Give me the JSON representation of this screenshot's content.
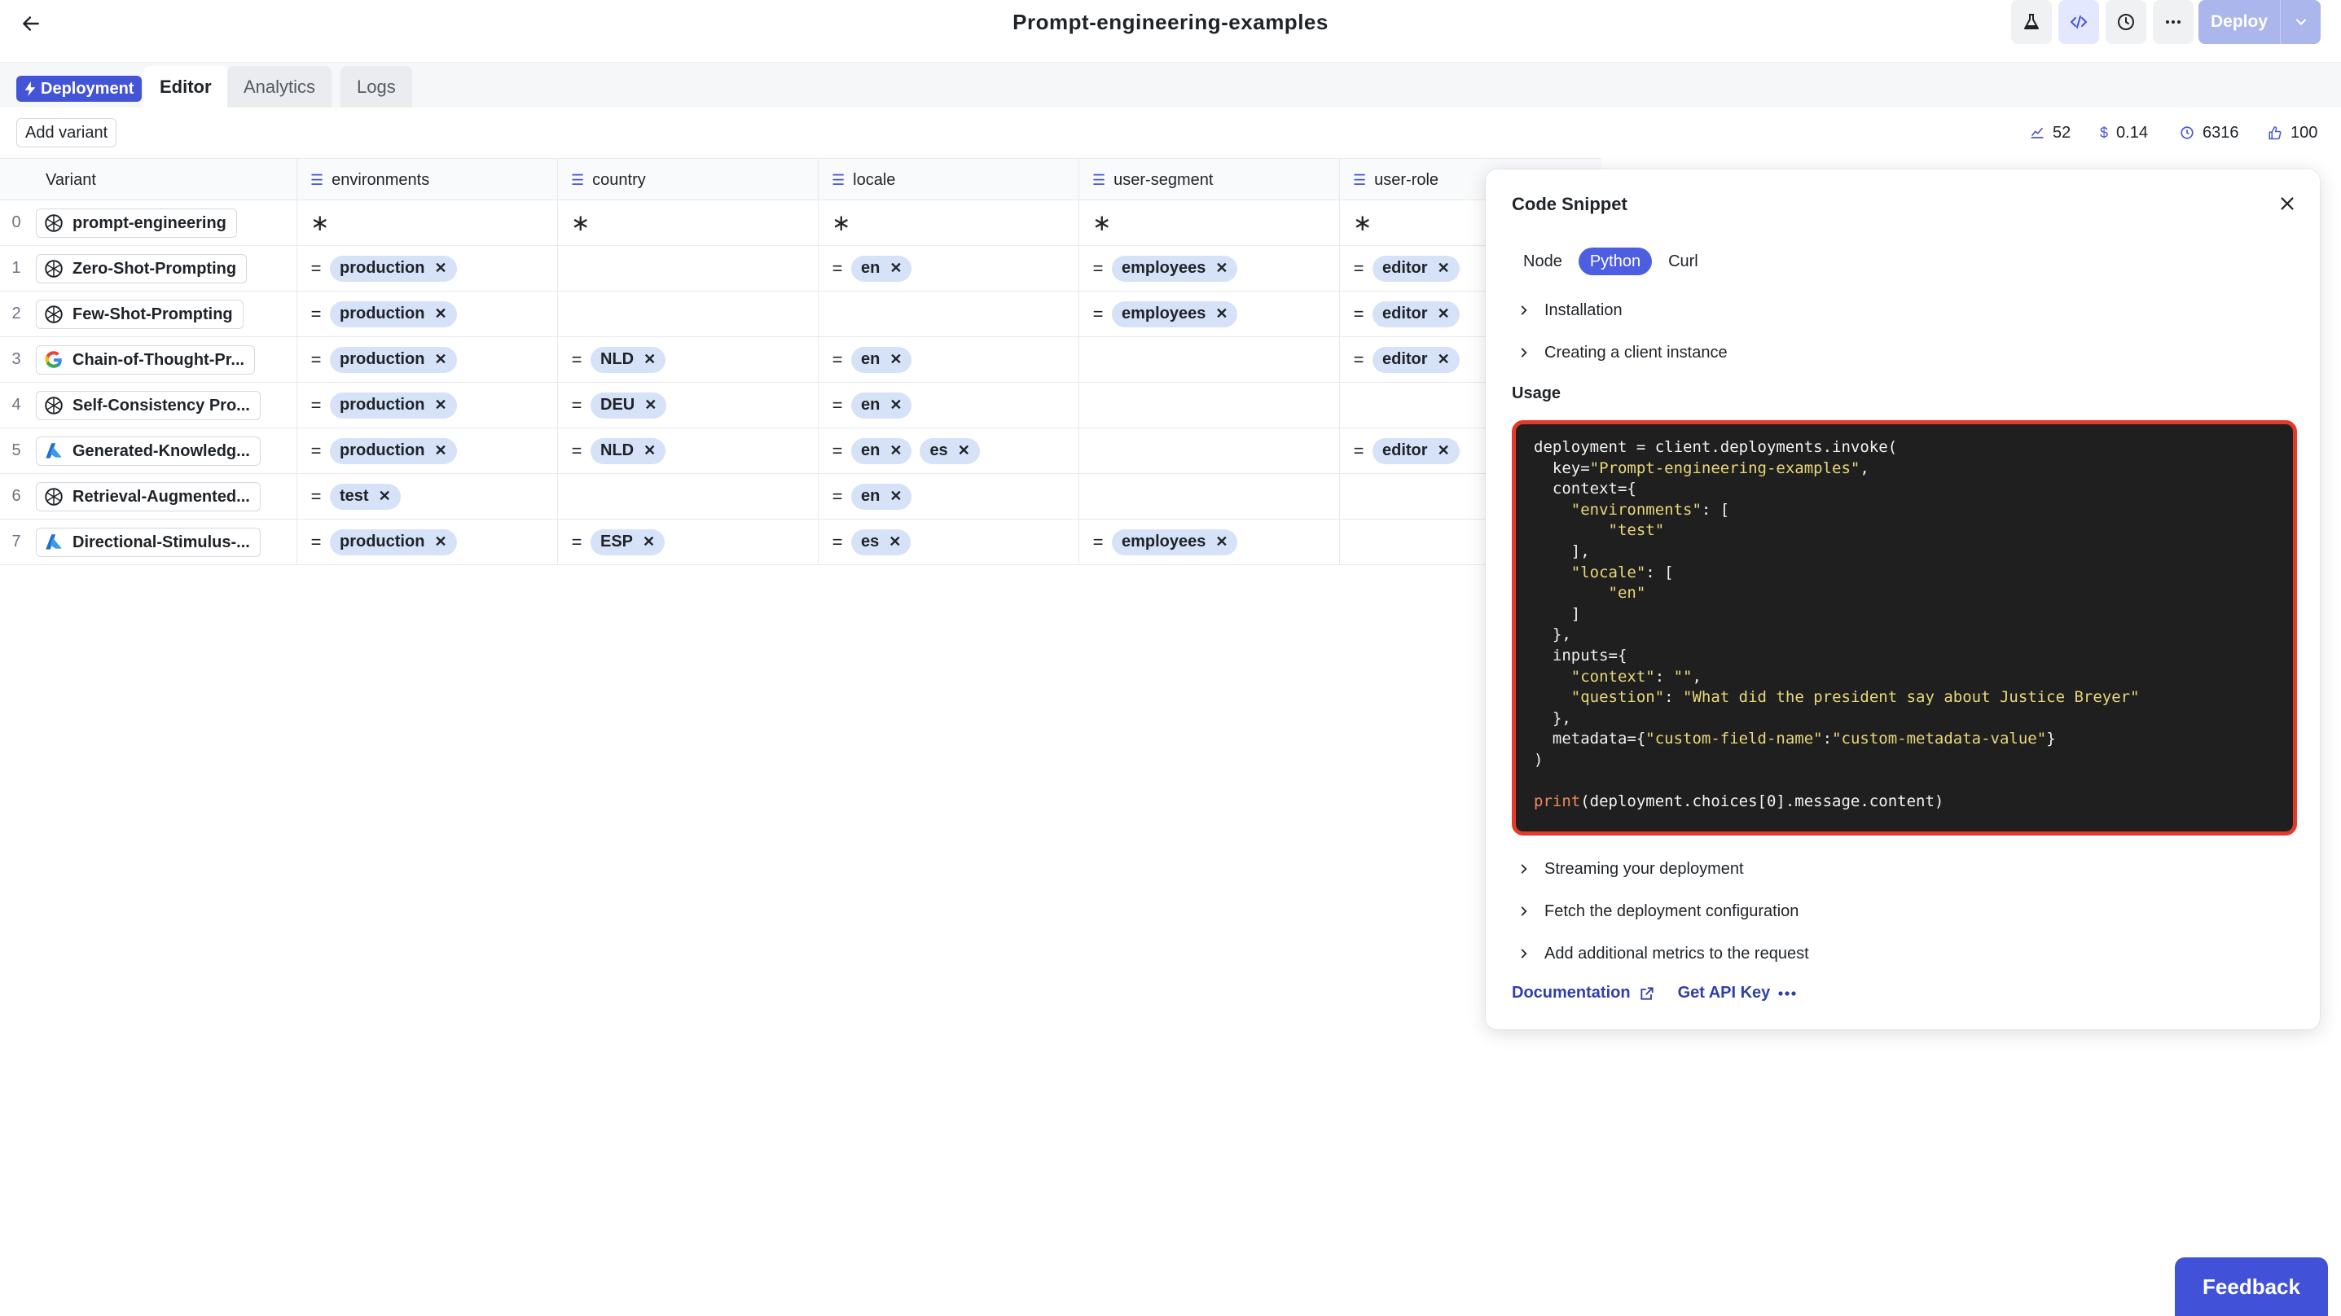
{
  "header": {
    "title": "Prompt-engineering-examples",
    "deploy_label": "Deploy"
  },
  "tabs": {
    "badge": "Deployment",
    "items": [
      "Editor",
      "Analytics",
      "Logs"
    ],
    "active": "Editor"
  },
  "toolbar": {
    "add_variant": "Add variant",
    "metrics": [
      {
        "icon": "chart-line-icon",
        "value": "52"
      },
      {
        "icon": "dollar-icon",
        "value": "0.14"
      },
      {
        "icon": "clock-icon",
        "value": "6316"
      },
      {
        "icon": "thumbs-up-icon",
        "value": "100"
      }
    ]
  },
  "table": {
    "columns": [
      "Variant",
      "environments",
      "country",
      "locale",
      "user-segment",
      "user-role"
    ],
    "rows": [
      {
        "idx": "0",
        "name": "prompt-engineering",
        "provider": "openai",
        "environments": [
          "*"
        ],
        "country": [
          "*"
        ],
        "locale": [
          "*"
        ],
        "segment": [
          "*"
        ],
        "role": [
          "*"
        ],
        "wildcard": true
      },
      {
        "idx": "1",
        "name": "Zero-Shot-Prompting",
        "provider": "openai",
        "environments": [
          "production"
        ],
        "country": [],
        "locale": [
          "en"
        ],
        "segment": [
          "employees"
        ],
        "role": [
          "editor"
        ]
      },
      {
        "idx": "2",
        "name": "Few-Shot-Prompting",
        "provider": "openai",
        "environments": [
          "production"
        ],
        "country": [],
        "locale": [],
        "segment": [
          "employees"
        ],
        "role": [
          "editor"
        ]
      },
      {
        "idx": "3",
        "name": "Chain-of-Thought-Pr...",
        "provider": "google",
        "environments": [
          "production"
        ],
        "country": [
          "NLD"
        ],
        "locale": [
          "en"
        ],
        "segment": [],
        "role": [
          "editor"
        ]
      },
      {
        "idx": "4",
        "name": "Self-Consistency Pro...",
        "provider": "openai",
        "environments": [
          "production"
        ],
        "country": [
          "DEU"
        ],
        "locale": [
          "en"
        ],
        "segment": [],
        "role": []
      },
      {
        "idx": "5",
        "name": "Generated-Knowledg...",
        "provider": "azure",
        "environments": [
          "production"
        ],
        "country": [
          "NLD"
        ],
        "locale": [
          "en",
          "es"
        ],
        "segment": [],
        "role": [
          "editor"
        ]
      },
      {
        "idx": "6",
        "name": "Retrieval-Augmented...",
        "provider": "openai",
        "environments": [
          "test"
        ],
        "country": [],
        "locale": [
          "en"
        ],
        "segment": [],
        "role": []
      },
      {
        "idx": "7",
        "name": "Directional-Stimulus-...",
        "provider": "azure",
        "environments": [
          "production"
        ],
        "country": [
          "ESP"
        ],
        "locale": [
          "es"
        ],
        "segment": [
          "employees"
        ],
        "role": []
      }
    ]
  },
  "panel": {
    "title": "Code Snippet",
    "languages": [
      "Node",
      "Python",
      "Curl"
    ],
    "active_language": "Python",
    "sections_top": [
      "Installation",
      "Creating a client instance"
    ],
    "usage_label": "Usage",
    "code_lines": [
      [
        [
          "t",
          "deployment = client.deployments.invoke("
        ]
      ],
      [
        [
          "t",
          "  key="
        ],
        [
          "s",
          "\"Prompt-engineering-examples\""
        ],
        [
          "t",
          ","
        ]
      ],
      [
        [
          "t",
          "  context={"
        ]
      ],
      [
        [
          "t",
          "    "
        ],
        [
          "s",
          "\"environments\""
        ],
        [
          "t",
          ": ["
        ]
      ],
      [
        [
          "t",
          "        "
        ],
        [
          "s",
          "\"test\""
        ]
      ],
      [
        [
          "t",
          "    ],"
        ]
      ],
      [
        [
          "t",
          "    "
        ],
        [
          "s",
          "\"locale\""
        ],
        [
          "t",
          ": ["
        ]
      ],
      [
        [
          "t",
          "        "
        ],
        [
          "s",
          "\"en\""
        ]
      ],
      [
        [
          "t",
          "    ]"
        ]
      ],
      [
        [
          "t",
          "  },"
        ]
      ],
      [
        [
          "t",
          "  inputs={"
        ]
      ],
      [
        [
          "t",
          "    "
        ],
        [
          "s",
          "\"context\""
        ],
        [
          "t",
          ": "
        ],
        [
          "s",
          "\"\""
        ],
        [
          "t",
          ","
        ]
      ],
      [
        [
          "t",
          "    "
        ],
        [
          "s",
          "\"question\""
        ],
        [
          "t",
          ": "
        ],
        [
          "s",
          "\"What did the president say about Justice Breyer\""
        ]
      ],
      [
        [
          "t",
          "  },"
        ]
      ],
      [
        [
          "t",
          "  metadata={"
        ],
        [
          "s",
          "\"custom-field-name\""
        ],
        [
          "t",
          ":"
        ],
        [
          "s",
          "\"custom-metadata-value\""
        ],
        [
          "t",
          "}"
        ]
      ],
      [
        [
          "t",
          ")"
        ]
      ],
      [
        [
          "t",
          ""
        ]
      ],
      [
        [
          "k",
          "print"
        ],
        [
          "t",
          "(deployment.choices[0].message.content)"
        ]
      ]
    ],
    "sections_bottom": [
      "Streaming your deployment",
      "Fetch the deployment configuration",
      "Add additional metrics to the request"
    ],
    "documentation_link": "Documentation",
    "api_key_link": "Get API Key"
  },
  "feedback": "Feedback"
}
